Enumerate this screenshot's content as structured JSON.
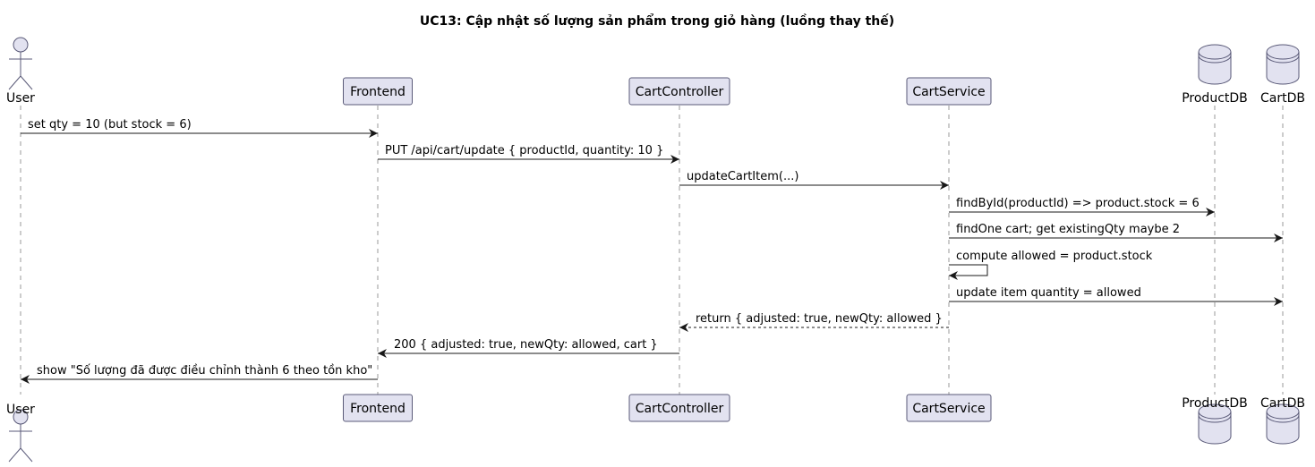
{
  "title": "UC13: Cập nhật số lượng sản phẩm trong giỏ hàng (luồng thay thế)",
  "colors": {
    "box_fill": "#E2E2F0",
    "box_stroke": "#5A5A78",
    "lifeline": "#999999",
    "line": "#181818"
  },
  "participants": [
    {
      "id": "user",
      "name": "User",
      "kind": "actor"
    },
    {
      "id": "frontend",
      "name": "Frontend",
      "kind": "participant"
    },
    {
      "id": "cartcontroller",
      "name": "CartController",
      "kind": "participant"
    },
    {
      "id": "cartservice",
      "name": "CartService",
      "kind": "participant"
    },
    {
      "id": "productdb",
      "name": "ProductDB",
      "kind": "database"
    },
    {
      "id": "cartdb",
      "name": "CartDB",
      "kind": "database"
    }
  ],
  "messages": [
    {
      "from": "user",
      "to": "frontend",
      "label": "set qty = 10 (but stock = 6)",
      "style": "solid"
    },
    {
      "from": "frontend",
      "to": "cartcontroller",
      "label": "PUT /api/cart/update { productId, quantity: 10 }",
      "style": "solid"
    },
    {
      "from": "cartcontroller",
      "to": "cartservice",
      "label": "updateCartItem(...)",
      "style": "solid"
    },
    {
      "from": "cartservice",
      "to": "productdb",
      "label": "findById(productId) => product.stock = 6",
      "style": "solid"
    },
    {
      "from": "cartservice",
      "to": "cartdb",
      "label": "findOne cart; get existingQty maybe 2",
      "style": "solid"
    },
    {
      "from": "cartservice",
      "to": "cartservice",
      "label": "compute allowed = product.stock",
      "style": "solid"
    },
    {
      "from": "cartservice",
      "to": "cartdb",
      "label": "update item quantity = allowed",
      "style": "solid"
    },
    {
      "from": "cartservice",
      "to": "cartcontroller",
      "label": "return { adjusted: true, newQty: allowed }",
      "style": "dashed"
    },
    {
      "from": "cartcontroller",
      "to": "frontend",
      "label": "200 { adjusted: true, newQty: allowed, cart }",
      "style": "solid"
    },
    {
      "from": "frontend",
      "to": "user",
      "label": "show \"Số lượng đã được điều chỉnh thành 6 theo tồn kho\"",
      "style": "solid"
    }
  ]
}
